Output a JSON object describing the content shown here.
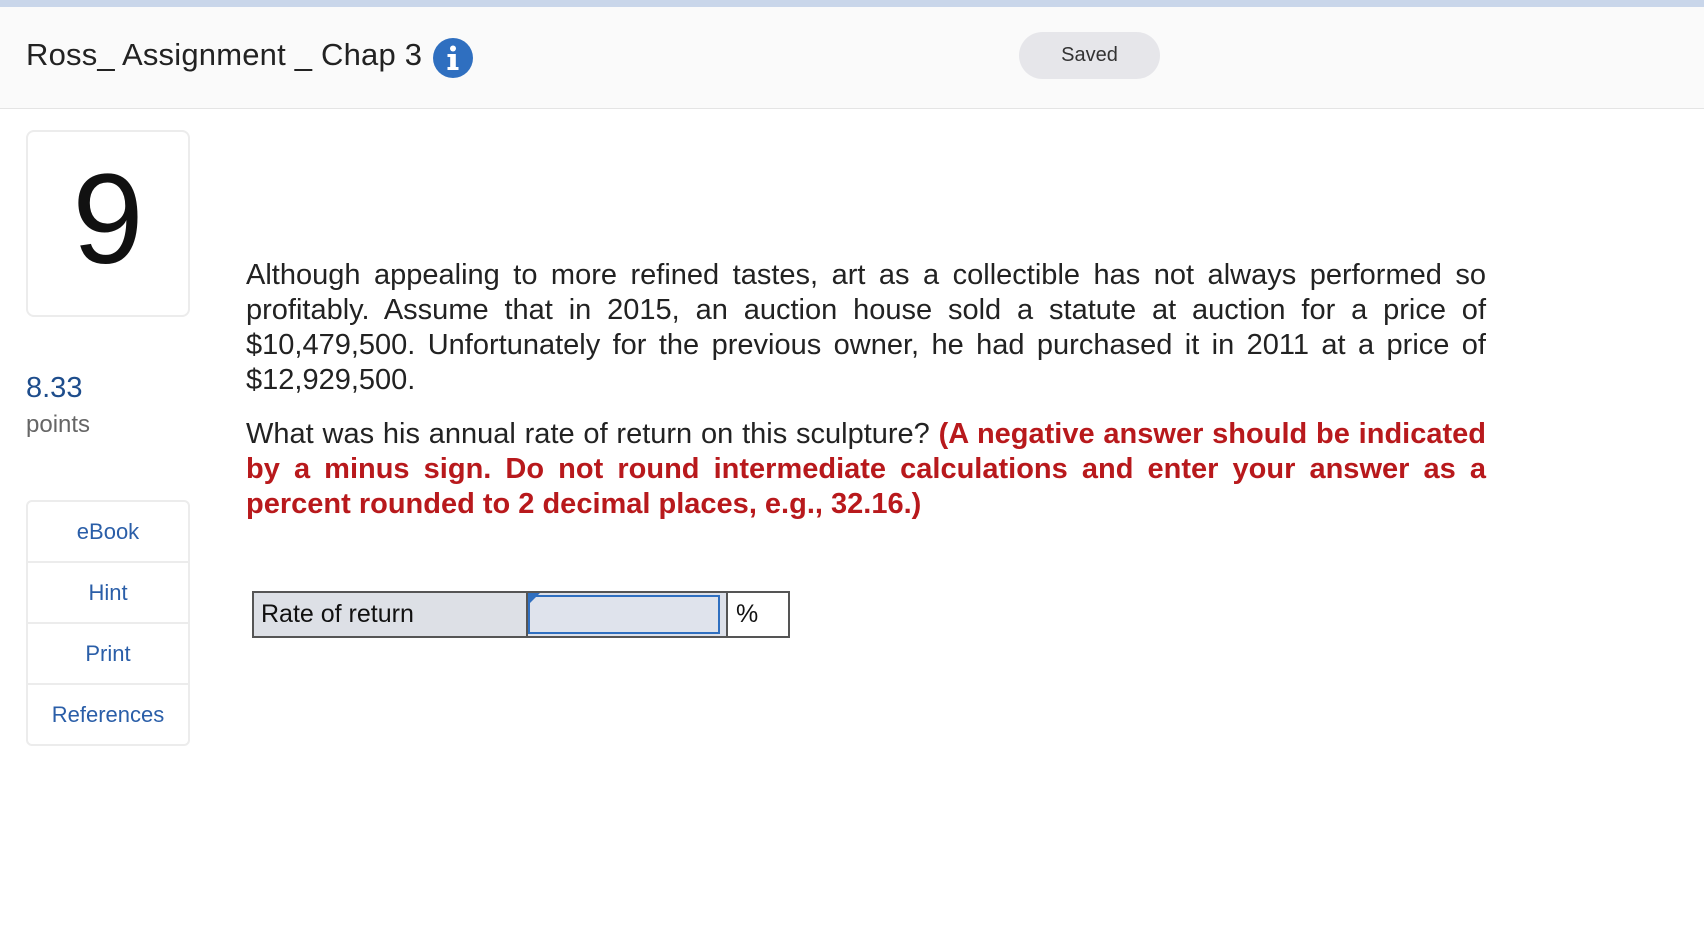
{
  "header": {
    "title": "Ross_ Assignment _ Chap 3",
    "info_icon": "info-circle-icon",
    "status": "Saved"
  },
  "question": {
    "number": "9",
    "points_value": "8.33",
    "points_label": "points",
    "paragraph1": "Although appealing to more refined tastes, art as a collectible has not always performed so profitably. Assume that in 2015, an auction house sold a statute at auction for a price of $10,479,500. Unfortunately for the previous owner, he had purchased it in 2011 at a price of $12,929,500.",
    "paragraph2": "What was his annual rate of return on this sculpture?",
    "instructions": "(A negative answer should be indicated by a minus sign. Do not round intermediate calculations and enter your answer as a percent rounded to 2 decimal places, e.g., 32.16.)"
  },
  "tools": {
    "ebook": "eBook",
    "hint": "Hint",
    "print": "Print",
    "references": "References"
  },
  "answer": {
    "label": "Rate of return",
    "value": "",
    "unit": "%"
  },
  "colors": {
    "accent": "#2f6fc0",
    "instruction_red": "#b8191c",
    "points_blue": "#1e4d8c"
  }
}
